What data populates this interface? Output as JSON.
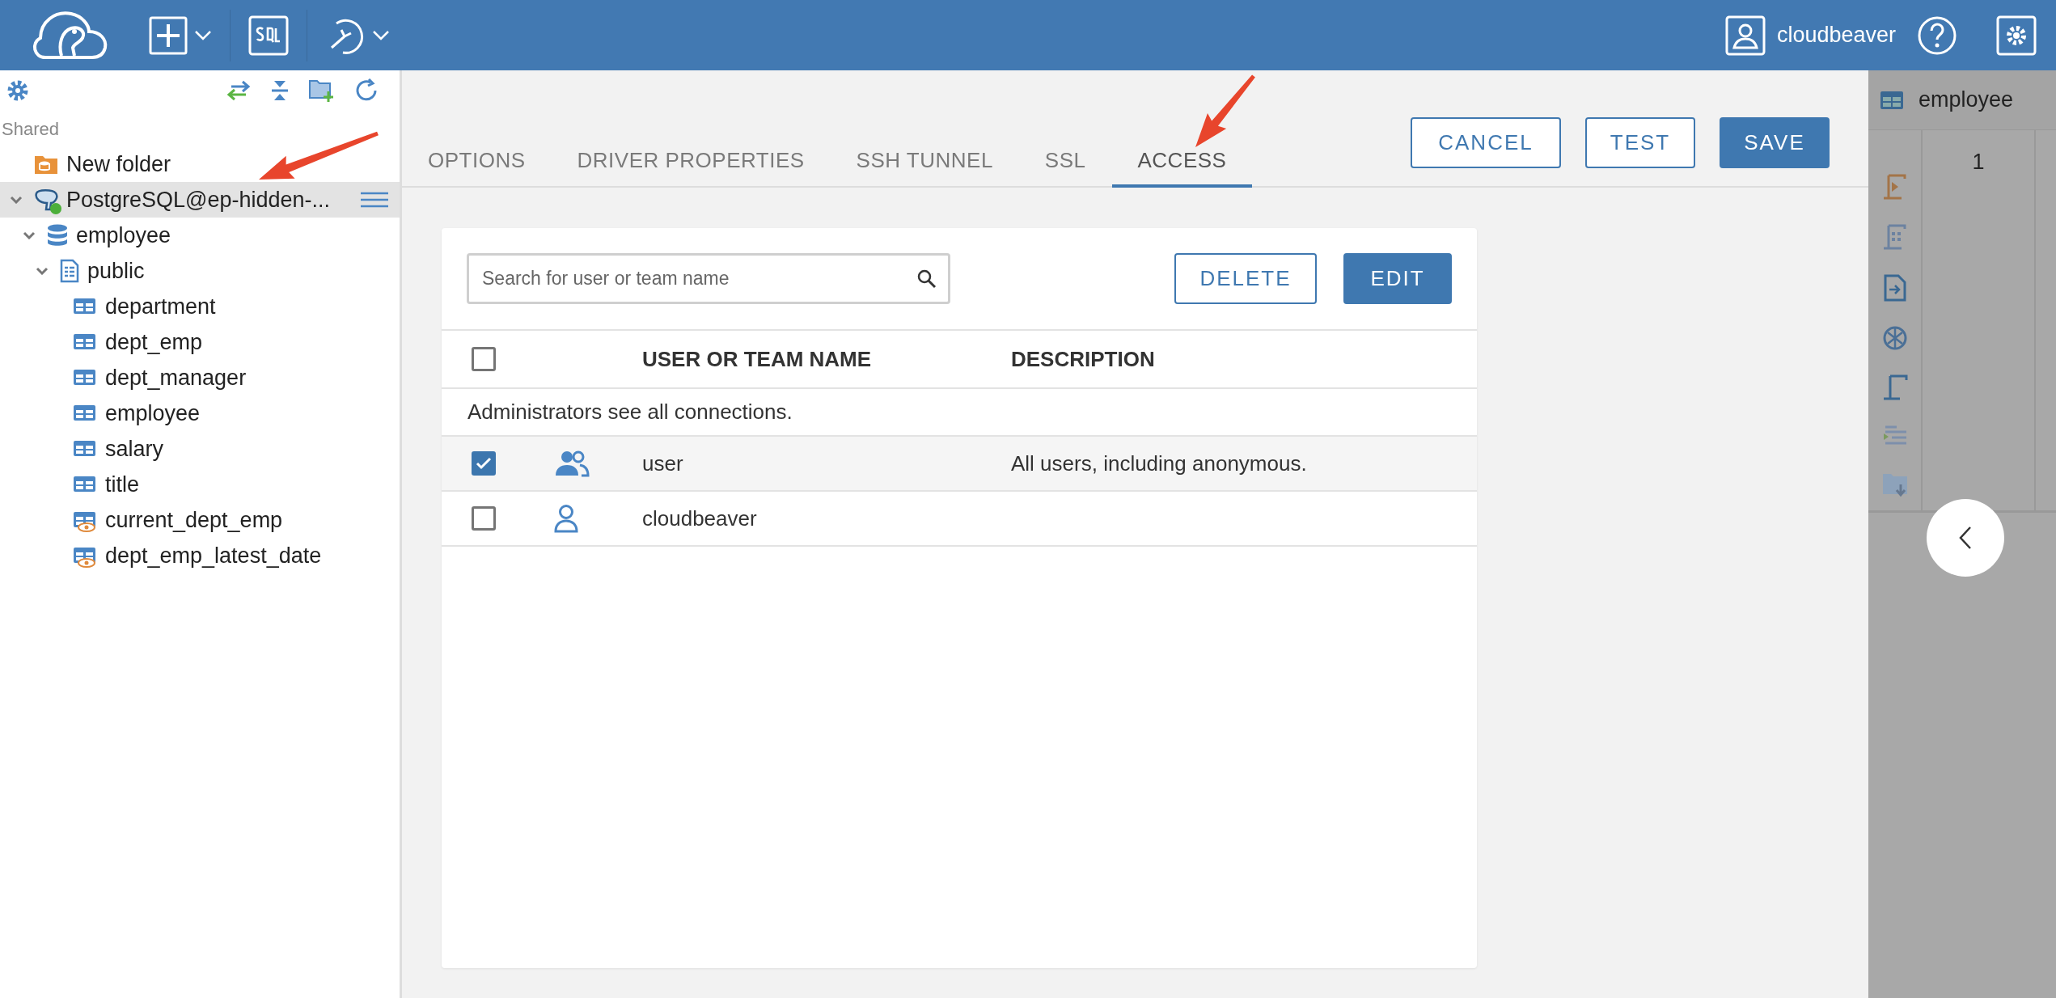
{
  "topbar": {
    "user": "cloudbeaver"
  },
  "sidebar": {
    "section": "Shared",
    "tree": [
      {
        "label": "New folder",
        "kind": "folder",
        "selected": false
      },
      {
        "label": "PostgreSQL@ep-hidden-...",
        "kind": "connection",
        "selected": true,
        "expanded": true,
        "connected": true,
        "children": [
          {
            "label": "employee",
            "kind": "database",
            "selected": false,
            "expanded": true,
            "children": [
              {
                "label": "public",
                "kind": "schema",
                "selected": false,
                "expanded": true,
                "children": [
                  {
                    "label": "department",
                    "kind": "table",
                    "selected": false
                  },
                  {
                    "label": "dept_emp",
                    "kind": "table",
                    "selected": false
                  },
                  {
                    "label": "dept_manager",
                    "kind": "table",
                    "selected": false
                  },
                  {
                    "label": "employee",
                    "kind": "table",
                    "selected": false
                  },
                  {
                    "label": "salary",
                    "kind": "table",
                    "selected": false
                  },
                  {
                    "label": "title",
                    "kind": "table",
                    "selected": false
                  },
                  {
                    "label": "current_dept_emp",
                    "kind": "view",
                    "selected": false
                  },
                  {
                    "label": "dept_emp_latest_date",
                    "kind": "view",
                    "selected": false
                  }
                ]
              }
            ]
          }
        ]
      }
    ]
  },
  "tabs": [
    {
      "label": "OPTIONS",
      "selected": false
    },
    {
      "label": "DRIVER PROPERTIES",
      "selected": false
    },
    {
      "label": "SSH TUNNEL",
      "selected": false
    },
    {
      "label": "SSL",
      "selected": false
    },
    {
      "label": "ACCESS",
      "selected": true
    }
  ],
  "actions": [
    {
      "label": "CANCEL",
      "kind": "outline"
    },
    {
      "label": "TEST",
      "kind": "outline"
    },
    {
      "label": "SAVE",
      "kind": "primary"
    }
  ],
  "access": {
    "search": {
      "placeholder": "Search for user or team name"
    },
    "buttons": [
      {
        "label": "DELETE",
        "kind": "outline"
      },
      {
        "label": "EDIT",
        "kind": "primary"
      }
    ],
    "all_checked": false,
    "columns": [
      "USER OR TEAM NAME",
      "DESCRIPTION"
    ],
    "note": "Administrators see all connections.",
    "rows": [
      {
        "name": "user",
        "description": "All users, including anonymous.",
        "kind": "team",
        "checked": true
      },
      {
        "name": "cloudbeaver",
        "kind": "user",
        "checked": false
      }
    ]
  },
  "editor": {
    "tab": "employee",
    "line_numbers": [
      "1"
    ]
  }
}
